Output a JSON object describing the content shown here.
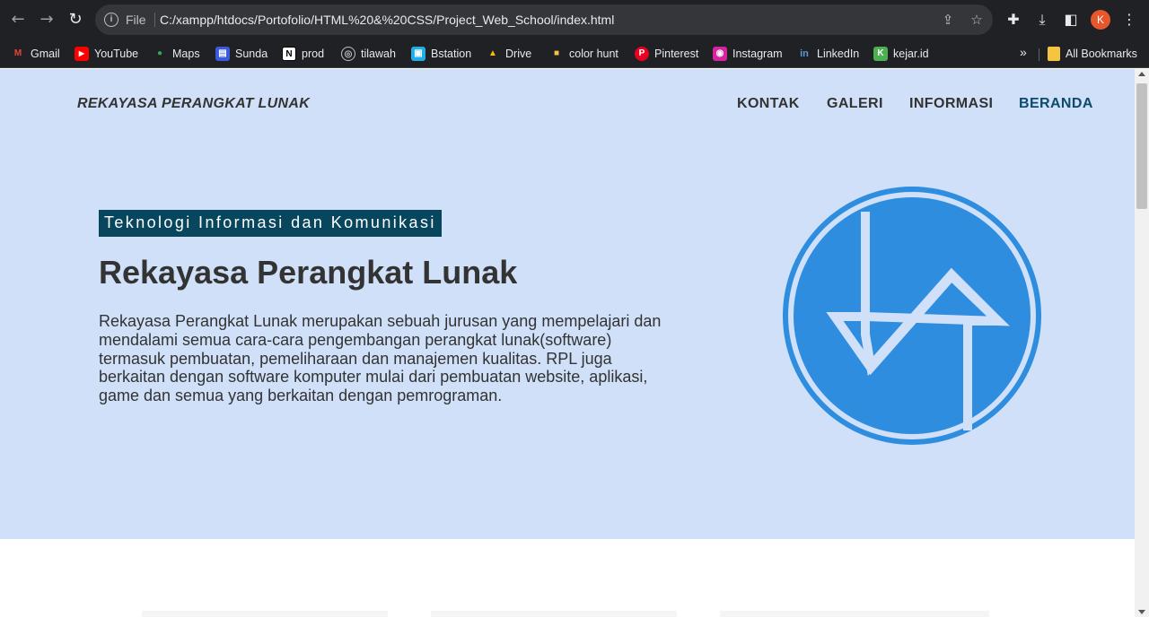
{
  "browser": {
    "back_icon": "arrow-left-icon",
    "forward_icon": "arrow-right-icon",
    "reload_icon": "reload-icon",
    "file_label": "File",
    "url": "C:/xampp/htdocs/Portofolio/HTML%20&%20CSS/Project_Web_School/index.html",
    "avatar_letter": "K",
    "avatar_color": "#e8572c"
  },
  "bookmarks": {
    "items": [
      {
        "label": "Gmail",
        "icon": "gmail-icon",
        "color": "#ea4335",
        "glyph": "M"
      },
      {
        "label": "YouTube",
        "icon": "youtube-icon",
        "color": "#ff0000",
        "glyph": "▶"
      },
      {
        "label": "Maps",
        "icon": "maps-icon",
        "color": "#34a853",
        "glyph": "●"
      },
      {
        "label": "Sunda",
        "icon": "sunda-icon",
        "color": "#3b5bdb",
        "glyph": "▤"
      },
      {
        "label": "prod",
        "icon": "notion-icon",
        "color": "#ffffff",
        "glyph": "N"
      },
      {
        "label": "tilawah",
        "icon": "tilawah-icon",
        "color": "#5f6368",
        "glyph": "◎"
      },
      {
        "label": "Bstation",
        "icon": "bstation-icon",
        "color": "#23ade5",
        "glyph": "▣"
      },
      {
        "label": "Drive",
        "icon": "drive-icon",
        "color": "#fbbc04",
        "glyph": "▲"
      },
      {
        "label": "color hunt",
        "icon": "colorhunt-icon",
        "color": "#f5c242",
        "glyph": "■"
      },
      {
        "label": "Pinterest",
        "icon": "pinterest-icon",
        "color": "#e60023",
        "glyph": "P"
      },
      {
        "label": "Instagram",
        "icon": "instagram-icon",
        "color": "#d6249f",
        "glyph": "◉"
      },
      {
        "label": "LinkedIn",
        "icon": "linkedin-icon",
        "color": "#0a66c2",
        "glyph": "in"
      },
      {
        "label": "kejar.id",
        "icon": "kejar-icon",
        "color": "#4caf50",
        "glyph": "K"
      }
    ],
    "more": "»",
    "all_bookmarks": "All Bookmarks"
  },
  "site": {
    "brand": "REKAYASA PERANGKAT LUNAK",
    "nav": [
      "KONTAK",
      "GALERI",
      "INFORMASI",
      "BERANDA"
    ],
    "tag": "Teknologi Informasi dan Komunikasi",
    "title": "Rekayasa Perangkat Lunak",
    "description": "Rekayasa Perangkat Lunak merupakan sebuah jurusan yang mempelajari dan mendalami semua cara-cara pengembangan perangkat lunak(software) termasuk pembuatan, pemeliharaan dan manajemen kualitas. RPL juga berkaitan dengan software komputer mulai dari pembuatan website, aplikasi, game dan semua yang berkaitan dengan pemrograman.",
    "logo_icon": "rpl-logo-icon",
    "colors": {
      "hero_bg": "#cfe0f8",
      "tag_bg": "#08465e",
      "logo_blue": "#2f8de0",
      "active_nav": "#0e4a6b"
    }
  }
}
